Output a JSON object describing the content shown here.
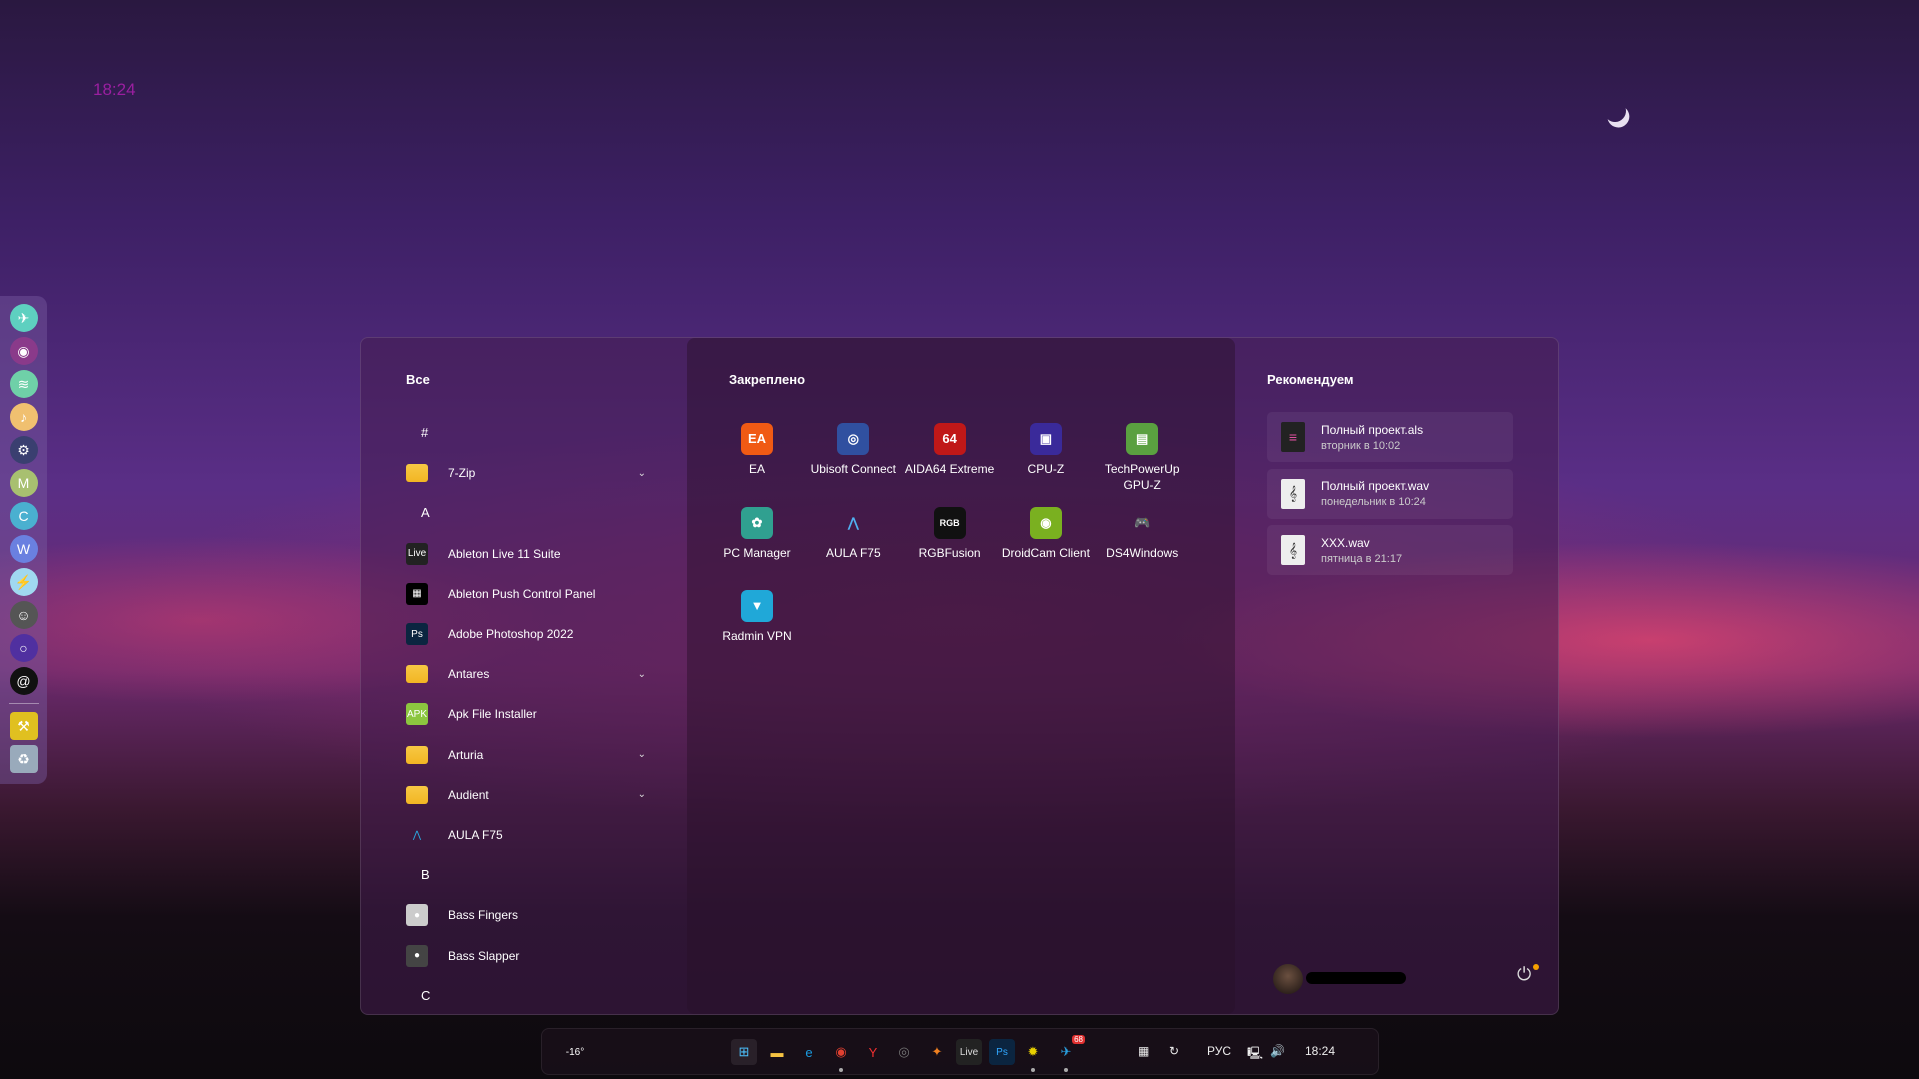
{
  "desktop": {
    "clock": "18:24"
  },
  "dock": {
    "items": [
      {
        "name": "telegram",
        "glyph": "✈",
        "color": "#5ed0c0"
      },
      {
        "name": "discord",
        "glyph": "◉",
        "color": "#8a3a8a"
      },
      {
        "name": "spotify",
        "glyph": "≋",
        "color": "#6fd0a8"
      },
      {
        "name": "music",
        "glyph": "♪",
        "color": "#f0c070"
      },
      {
        "name": "steam",
        "glyph": "⚙",
        "color": "#3a3f70"
      },
      {
        "name": "minecraft",
        "glyph": "M",
        "color": "#a8c070"
      },
      {
        "name": "cities-skylines",
        "glyph": "C",
        "color": "#4ab0d0"
      },
      {
        "name": "game-wolf",
        "glyph": "W",
        "color": "#6a80e0"
      },
      {
        "name": "game-lightning",
        "glyph": "⚡",
        "color": "#a0d8f0"
      },
      {
        "name": "agent",
        "glyph": "☺",
        "color": "#555"
      },
      {
        "name": "ring-app",
        "glyph": "○",
        "color": "#5030a0"
      },
      {
        "name": "spiral-app",
        "glyph": "@",
        "color": "#111"
      }
    ],
    "bottom": [
      {
        "name": "tools",
        "glyph": "⚒",
        "color": "#e0c020"
      },
      {
        "name": "recycle-bin",
        "glyph": "♻",
        "color": "#9ab"
      }
    ]
  },
  "start": {
    "all_title": "Все",
    "list": [
      {
        "type": "letter",
        "label": "#"
      },
      {
        "type": "folder",
        "label": "7-Zip"
      },
      {
        "type": "letter",
        "label": "A"
      },
      {
        "type": "app",
        "label": "Ableton Live 11 Suite",
        "icon": "Live",
        "color": "#222"
      },
      {
        "type": "app",
        "label": "Ableton Push Control Panel",
        "icon": "▦",
        "color": "#000"
      },
      {
        "type": "app",
        "label": "Adobe Photoshop 2022",
        "icon": "Ps",
        "color": "#0b2540"
      },
      {
        "type": "folder",
        "label": "Antares"
      },
      {
        "type": "app",
        "label": "Apk File Installer",
        "icon": "APK",
        "color": "#8cc63f"
      },
      {
        "type": "folder",
        "label": "Arturia"
      },
      {
        "type": "folder",
        "label": "Audient"
      },
      {
        "type": "app",
        "label": "AULA F75",
        "icon": "⋀",
        "color": "transparent"
      },
      {
        "type": "letter",
        "label": "B"
      },
      {
        "type": "app",
        "label": "Bass Fingers",
        "icon": "●",
        "color": "#ccc"
      },
      {
        "type": "app",
        "label": "Bass Slapper",
        "icon": "●",
        "color": "#444"
      },
      {
        "type": "letter",
        "label": "C"
      }
    ],
    "pinned_title": "Закреплено",
    "pinned": [
      {
        "label": "EA",
        "icon": "EA",
        "color": "#f05a14"
      },
      {
        "label": "Ubisoft Connect",
        "icon": "◎",
        "color": "#3050a0"
      },
      {
        "label": "AIDA64 Extreme",
        "icon": "64",
        "color": "#c01818"
      },
      {
        "label": "CPU-Z",
        "icon": "▣",
        "color": "#3a2a9a"
      },
      {
        "label": "TechPowerUp GPU-Z",
        "icon": "▤",
        "color": "#5aa040"
      },
      {
        "label": "PC Manager",
        "icon": "✿",
        "color": "#30a090"
      },
      {
        "label": "AULA F75",
        "icon": "⋀",
        "color": "transparent"
      },
      {
        "label": "RGBFusion",
        "icon": "RGB",
        "color": "#111"
      },
      {
        "label": "DroidCam Client",
        "icon": "◉",
        "color": "#7ab020"
      },
      {
        "label": "DS4Windows",
        "icon": "🎮",
        "color": "transparent"
      },
      {
        "label": "Radmin VPN",
        "icon": "▼",
        "color": "#20a8d8"
      }
    ],
    "recommended_title": "Рекомендуем",
    "recommended": [
      {
        "title": "Полный проект.als",
        "subtitle": "вторник в 10:02",
        "icon": "≡",
        "color": "#222"
      },
      {
        "title": "Полный проект.wav",
        "subtitle": "понедельник в 10:24",
        "icon": "𝄞",
        "color": "#eee"
      },
      {
        "title": "XXX.wav",
        "subtitle": "пятница в 21:17",
        "icon": "𝄞",
        "color": "#eee"
      }
    ]
  },
  "taskbar": {
    "weather": "-16°",
    "apps": [
      {
        "name": "start",
        "glyph": "⊞",
        "color": "#4cc2ff"
      },
      {
        "name": "file-explorer",
        "glyph": "▬",
        "color": "#f5c242"
      },
      {
        "name": "edge",
        "glyph": "e",
        "color": "#1a9be0"
      },
      {
        "name": "chrome",
        "glyph": "◉",
        "color": "#e04030"
      },
      {
        "name": "yandex-browser",
        "glyph": "Y",
        "color": "#f03030"
      },
      {
        "name": "obs",
        "glyph": "◎",
        "color": "#777"
      },
      {
        "name": "fl-studio",
        "glyph": "✦",
        "color": "#f08020"
      },
      {
        "name": "ableton-live",
        "glyph": "Live",
        "color": "#222"
      },
      {
        "name": "photoshop",
        "glyph": "Ps",
        "color": "#0b2540"
      },
      {
        "name": "sun-app",
        "glyph": "✹",
        "color": "#e8d000"
      },
      {
        "name": "telegram",
        "glyph": "✈",
        "color": "#2aa0e0"
      }
    ],
    "telegram_badge": "68",
    "language": "РУС",
    "time": "18:24"
  }
}
